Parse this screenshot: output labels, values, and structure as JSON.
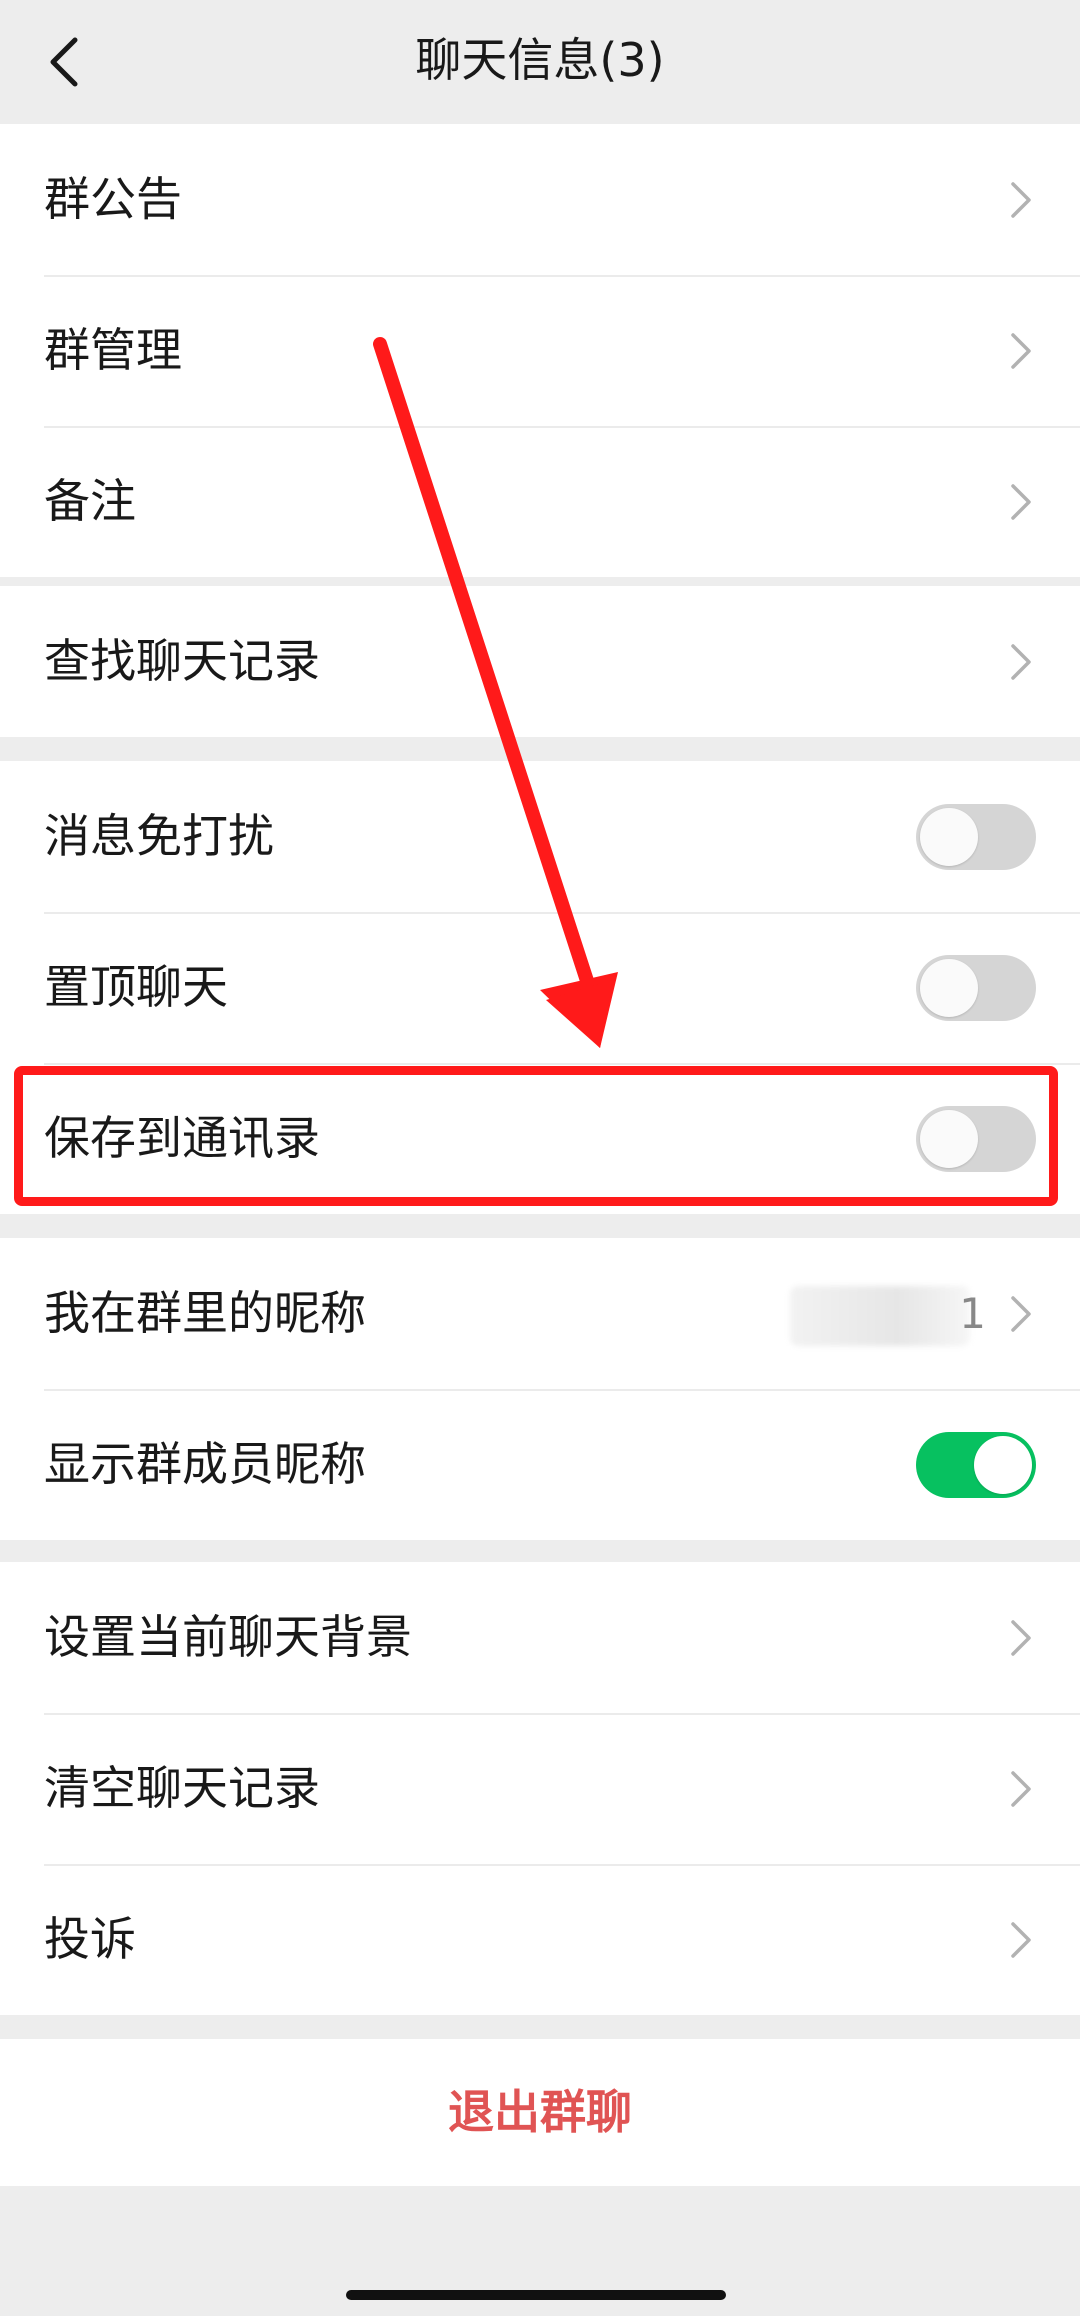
{
  "header": {
    "title": "聊天信息(3)",
    "back_icon": "chevron-left-icon"
  },
  "group1": [
    {
      "label": "群公告"
    },
    {
      "label": "群管理"
    },
    {
      "label": "备注"
    }
  ],
  "group2": [
    {
      "label": "查找聊天记录"
    }
  ],
  "group3": [
    {
      "label": "消息免打扰",
      "toggle_on": false
    },
    {
      "label": "置顶聊天",
      "toggle_on": false
    },
    {
      "label": "保存到通讯录",
      "toggle_on": false
    }
  ],
  "group4": [
    {
      "label": "我在群里的昵称",
      "value": "1"
    },
    {
      "label": "显示群成员昵称",
      "toggle_on": true
    }
  ],
  "group5": [
    {
      "label": "设置当前聊天背景"
    },
    {
      "label": "清空聊天记录"
    },
    {
      "label": "投诉"
    }
  ],
  "exit": {
    "label": "退出群聊"
  },
  "colors": {
    "toggle_on": "#07c160",
    "toggle_off": "#d5d5d5",
    "exit_text": "#e05454",
    "annotation": "#ff1a1a"
  }
}
